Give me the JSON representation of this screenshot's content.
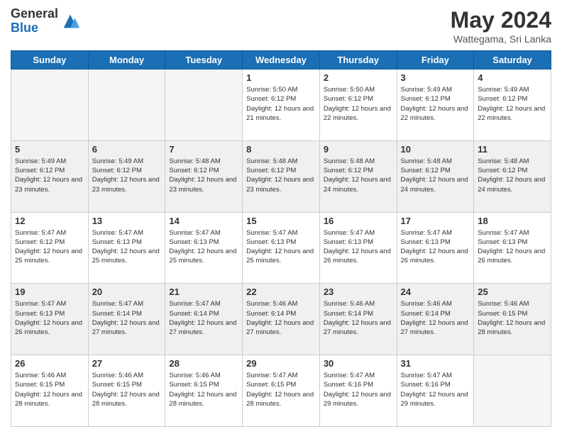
{
  "logo": {
    "general": "General",
    "blue": "Blue"
  },
  "title": {
    "month_year": "May 2024",
    "location": "Wattegama, Sri Lanka"
  },
  "days_of_week": [
    "Sunday",
    "Monday",
    "Tuesday",
    "Wednesday",
    "Thursday",
    "Friday",
    "Saturday"
  ],
  "weeks": [
    [
      {
        "num": "",
        "info": ""
      },
      {
        "num": "",
        "info": ""
      },
      {
        "num": "",
        "info": ""
      },
      {
        "num": "1",
        "info": "Sunrise: 5:50 AM\nSunset: 6:12 PM\nDaylight: 12 hours and 21 minutes."
      },
      {
        "num": "2",
        "info": "Sunrise: 5:50 AM\nSunset: 6:12 PM\nDaylight: 12 hours and 22 minutes."
      },
      {
        "num": "3",
        "info": "Sunrise: 5:49 AM\nSunset: 6:12 PM\nDaylight: 12 hours and 22 minutes."
      },
      {
        "num": "4",
        "info": "Sunrise: 5:49 AM\nSunset: 6:12 PM\nDaylight: 12 hours and 22 minutes."
      }
    ],
    [
      {
        "num": "5",
        "info": "Sunrise: 5:49 AM\nSunset: 6:12 PM\nDaylight: 12 hours and 23 minutes."
      },
      {
        "num": "6",
        "info": "Sunrise: 5:49 AM\nSunset: 6:12 PM\nDaylight: 12 hours and 23 minutes."
      },
      {
        "num": "7",
        "info": "Sunrise: 5:48 AM\nSunset: 6:12 PM\nDaylight: 12 hours and 23 minutes."
      },
      {
        "num": "8",
        "info": "Sunrise: 5:48 AM\nSunset: 6:12 PM\nDaylight: 12 hours and 23 minutes."
      },
      {
        "num": "9",
        "info": "Sunrise: 5:48 AM\nSunset: 6:12 PM\nDaylight: 12 hours and 24 minutes."
      },
      {
        "num": "10",
        "info": "Sunrise: 5:48 AM\nSunset: 6:12 PM\nDaylight: 12 hours and 24 minutes."
      },
      {
        "num": "11",
        "info": "Sunrise: 5:48 AM\nSunset: 6:12 PM\nDaylight: 12 hours and 24 minutes."
      }
    ],
    [
      {
        "num": "12",
        "info": "Sunrise: 5:47 AM\nSunset: 6:12 PM\nDaylight: 12 hours and 25 minutes."
      },
      {
        "num": "13",
        "info": "Sunrise: 5:47 AM\nSunset: 6:13 PM\nDaylight: 12 hours and 25 minutes."
      },
      {
        "num": "14",
        "info": "Sunrise: 5:47 AM\nSunset: 6:13 PM\nDaylight: 12 hours and 25 minutes."
      },
      {
        "num": "15",
        "info": "Sunrise: 5:47 AM\nSunset: 6:13 PM\nDaylight: 12 hours and 25 minutes."
      },
      {
        "num": "16",
        "info": "Sunrise: 5:47 AM\nSunset: 6:13 PM\nDaylight: 12 hours and 26 minutes."
      },
      {
        "num": "17",
        "info": "Sunrise: 5:47 AM\nSunset: 6:13 PM\nDaylight: 12 hours and 26 minutes."
      },
      {
        "num": "18",
        "info": "Sunrise: 5:47 AM\nSunset: 6:13 PM\nDaylight: 12 hours and 26 minutes."
      }
    ],
    [
      {
        "num": "19",
        "info": "Sunrise: 5:47 AM\nSunset: 6:13 PM\nDaylight: 12 hours and 26 minutes."
      },
      {
        "num": "20",
        "info": "Sunrise: 5:47 AM\nSunset: 6:14 PM\nDaylight: 12 hours and 27 minutes."
      },
      {
        "num": "21",
        "info": "Sunrise: 5:47 AM\nSunset: 6:14 PM\nDaylight: 12 hours and 27 minutes."
      },
      {
        "num": "22",
        "info": "Sunrise: 5:46 AM\nSunset: 6:14 PM\nDaylight: 12 hours and 27 minutes."
      },
      {
        "num": "23",
        "info": "Sunrise: 5:46 AM\nSunset: 6:14 PM\nDaylight: 12 hours and 27 minutes."
      },
      {
        "num": "24",
        "info": "Sunrise: 5:46 AM\nSunset: 6:14 PM\nDaylight: 12 hours and 27 minutes."
      },
      {
        "num": "25",
        "info": "Sunrise: 5:46 AM\nSunset: 6:15 PM\nDaylight: 12 hours and 28 minutes."
      }
    ],
    [
      {
        "num": "26",
        "info": "Sunrise: 5:46 AM\nSunset: 6:15 PM\nDaylight: 12 hours and 28 minutes."
      },
      {
        "num": "27",
        "info": "Sunrise: 5:46 AM\nSunset: 6:15 PM\nDaylight: 12 hours and 28 minutes."
      },
      {
        "num": "28",
        "info": "Sunrise: 5:46 AM\nSunset: 6:15 PM\nDaylight: 12 hours and 28 minutes."
      },
      {
        "num": "29",
        "info": "Sunrise: 5:47 AM\nSunset: 6:15 PM\nDaylight: 12 hours and 28 minutes."
      },
      {
        "num": "30",
        "info": "Sunrise: 5:47 AM\nSunset: 6:16 PM\nDaylight: 12 hours and 29 minutes."
      },
      {
        "num": "31",
        "info": "Sunrise: 5:47 AM\nSunset: 6:16 PM\nDaylight: 12 hours and 29 minutes."
      },
      {
        "num": "",
        "info": ""
      }
    ]
  ]
}
